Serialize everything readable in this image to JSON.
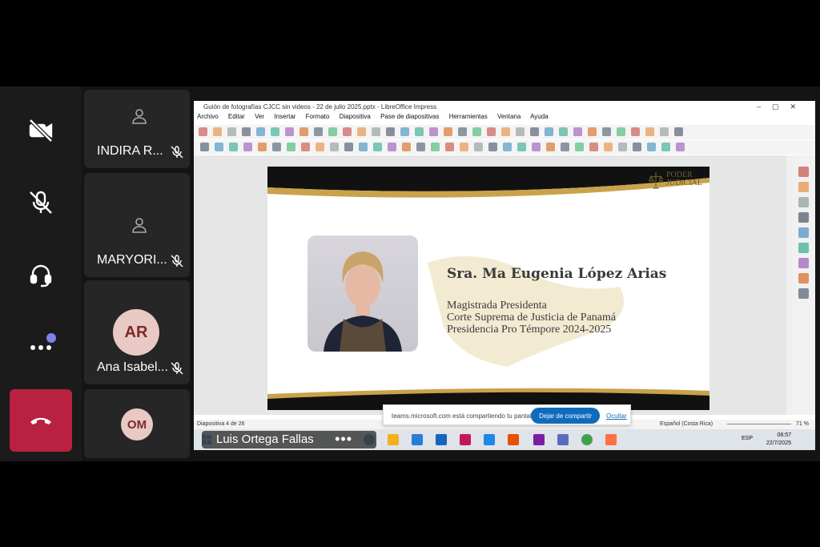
{
  "meeting": {
    "participants": [
      {
        "name": "INDIRA R..."
      },
      {
        "name": "MARYORI..."
      },
      {
        "name": "Ana Isabel...",
        "initials": "AR"
      },
      {
        "initials": "OM"
      }
    ],
    "presenter": {
      "name": "Luis Ortega Fallas",
      "more": "•••"
    }
  },
  "app": {
    "window_title": "Guión de fotografías CJCC sin videos - 22 de julio 2025.pptx - LibreOffice Impress",
    "menu": [
      "Archivo",
      "Editar",
      "Ver",
      "Insertar",
      "Formato",
      "Diapositiva",
      "Pase de diapositivas",
      "Herramientas",
      "Ventana",
      "Ayuda"
    ],
    "status": {
      "slide": "Diapositiva 4 de 26",
      "language": "Español (Costa Rica)",
      "zoom": "71 %"
    }
  },
  "slide": {
    "logo_line1": "PODER",
    "logo_line2": "JUDICIAL",
    "name": "Sra. Ma Eugenia López Arias",
    "line1": "Magistrada Presidenta",
    "line2": "Corte Suprema de Justicia de Panamá",
    "line3": "Presidencia Pro Témpore 2024-2025"
  },
  "share_banner": {
    "message": "teams.microsoft.com está compartiendo tu pantalla.",
    "stop_label": "Dejar de compartir",
    "hide_label": "Ocultar"
  },
  "taskbar": {
    "lang": "ESP",
    "time": "08:57",
    "date": "22/7/2025"
  },
  "colors": {
    "end_call": "#b8213f",
    "accent": "#0f6cbd",
    "gold": "#c9a24a"
  }
}
